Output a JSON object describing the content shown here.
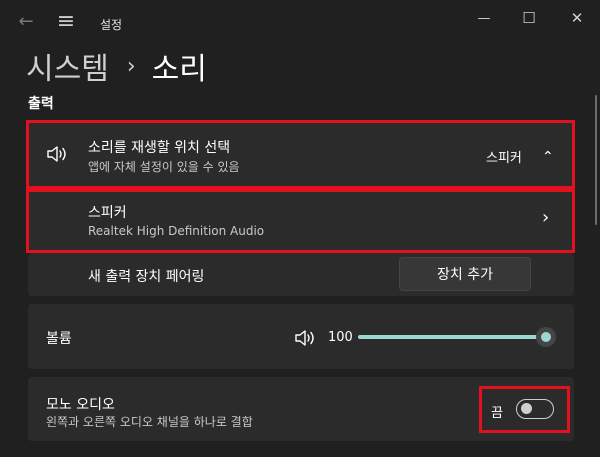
{
  "window": {
    "app_title": "설정",
    "back_glyph": "←",
    "menu_glyph": "≡",
    "minimize_glyph": "—",
    "maximize_glyph": "☐",
    "close_glyph": "✕"
  },
  "breadcrumb": {
    "parent": "시스템",
    "separator": "›",
    "current": "소리"
  },
  "output": {
    "section_title": "출력",
    "choose_device": {
      "title": "소리를 재생할 위치 선택",
      "subtitle": "앱에 자체 설정이 있을 수 있음",
      "value": "스피커",
      "icon": "speaker-icon",
      "chevron": "⌃"
    },
    "speaker_item": {
      "title": "스피커",
      "subtitle": "Realtek High Definition Audio",
      "chevron": "›"
    },
    "pair_device": {
      "label": "새 출력 장치 페어링",
      "button": "장치 추가"
    },
    "volume": {
      "label": "볼륨",
      "value_text": "100",
      "level_percent": 100,
      "icon": "speaker-icon"
    },
    "mono_audio": {
      "title": "모노 오디오",
      "subtitle": "왼쪽과 오른쪽 오디오 채널을 하나로 결합",
      "state_label": "끔",
      "on": false
    }
  },
  "colors": {
    "background": "#202020",
    "card": "#2b2b2b",
    "accent": "#9ed7d2",
    "highlight_box": "#e3101f"
  }
}
